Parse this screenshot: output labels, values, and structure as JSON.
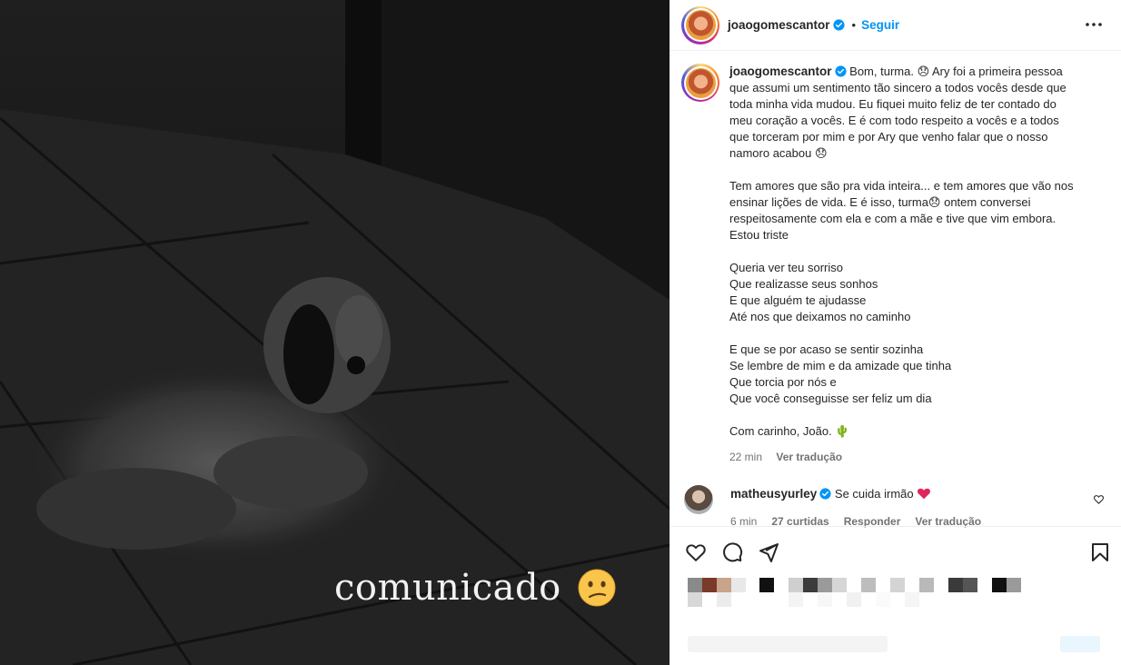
{
  "media": {
    "overlay_text": "comunicado",
    "overlay_emoji": "confused-face-emoji"
  },
  "post": {
    "author": "joaogomescantor",
    "follow_label": "Seguir",
    "separator": "•",
    "caption_lines": [
      [
        "Bom, turma. 😞 Ary foi a primeira pessoa",
        "que assumi um sentimento tão sincero a todos vocês desde que",
        "toda minha vida mudou. Eu fiquei muito feliz de ter contado do",
        "meu coração a vocês. E é com todo respeito a vocês e a todos",
        "que torceram por mim e por Ary que venho falar que o nosso",
        "namoro acabou 😞"
      ],
      [
        "Tem amores que são pra vida inteira... e tem amores que vão nos",
        "ensinar lições de vida. E é isso, turma😞 ontem conversei",
        "respeitosamente com ela e com a mãe e tive que vim embora.",
        "Estou triste"
      ],
      [
        "Queria ver teu sorriso",
        "Que realizasse seus sonhos",
        "E que alguém te ajudasse",
        "Até nos que deixamos no caminho"
      ],
      [
        "E que se por acaso se sentir sozinha",
        "Se lembre de mim e da amizade que tinha",
        "Que torcia por nós e",
        "Que você conseguisse ser feliz um dia"
      ],
      [
        "Com carinho, João. 🌵"
      ]
    ],
    "time": "22 min",
    "translate_label": "Ver tradução"
  },
  "comment": {
    "user": "matheusyurley",
    "text": "Se cuida irmão",
    "time": "6 min",
    "likes": "27 curtidas",
    "reply_label": "Responder",
    "translate_label": "Ver tradução"
  },
  "colors": {
    "link_blue": "#0095f6",
    "verified_blue": "#0095f6",
    "heart_red": "#ed4956",
    "muted": "#737373"
  },
  "icons": {
    "header_more": "more-horizontal-icon",
    "like": "heart-icon",
    "comment": "comment-icon",
    "share": "share-icon",
    "save": "bookmark-icon"
  }
}
